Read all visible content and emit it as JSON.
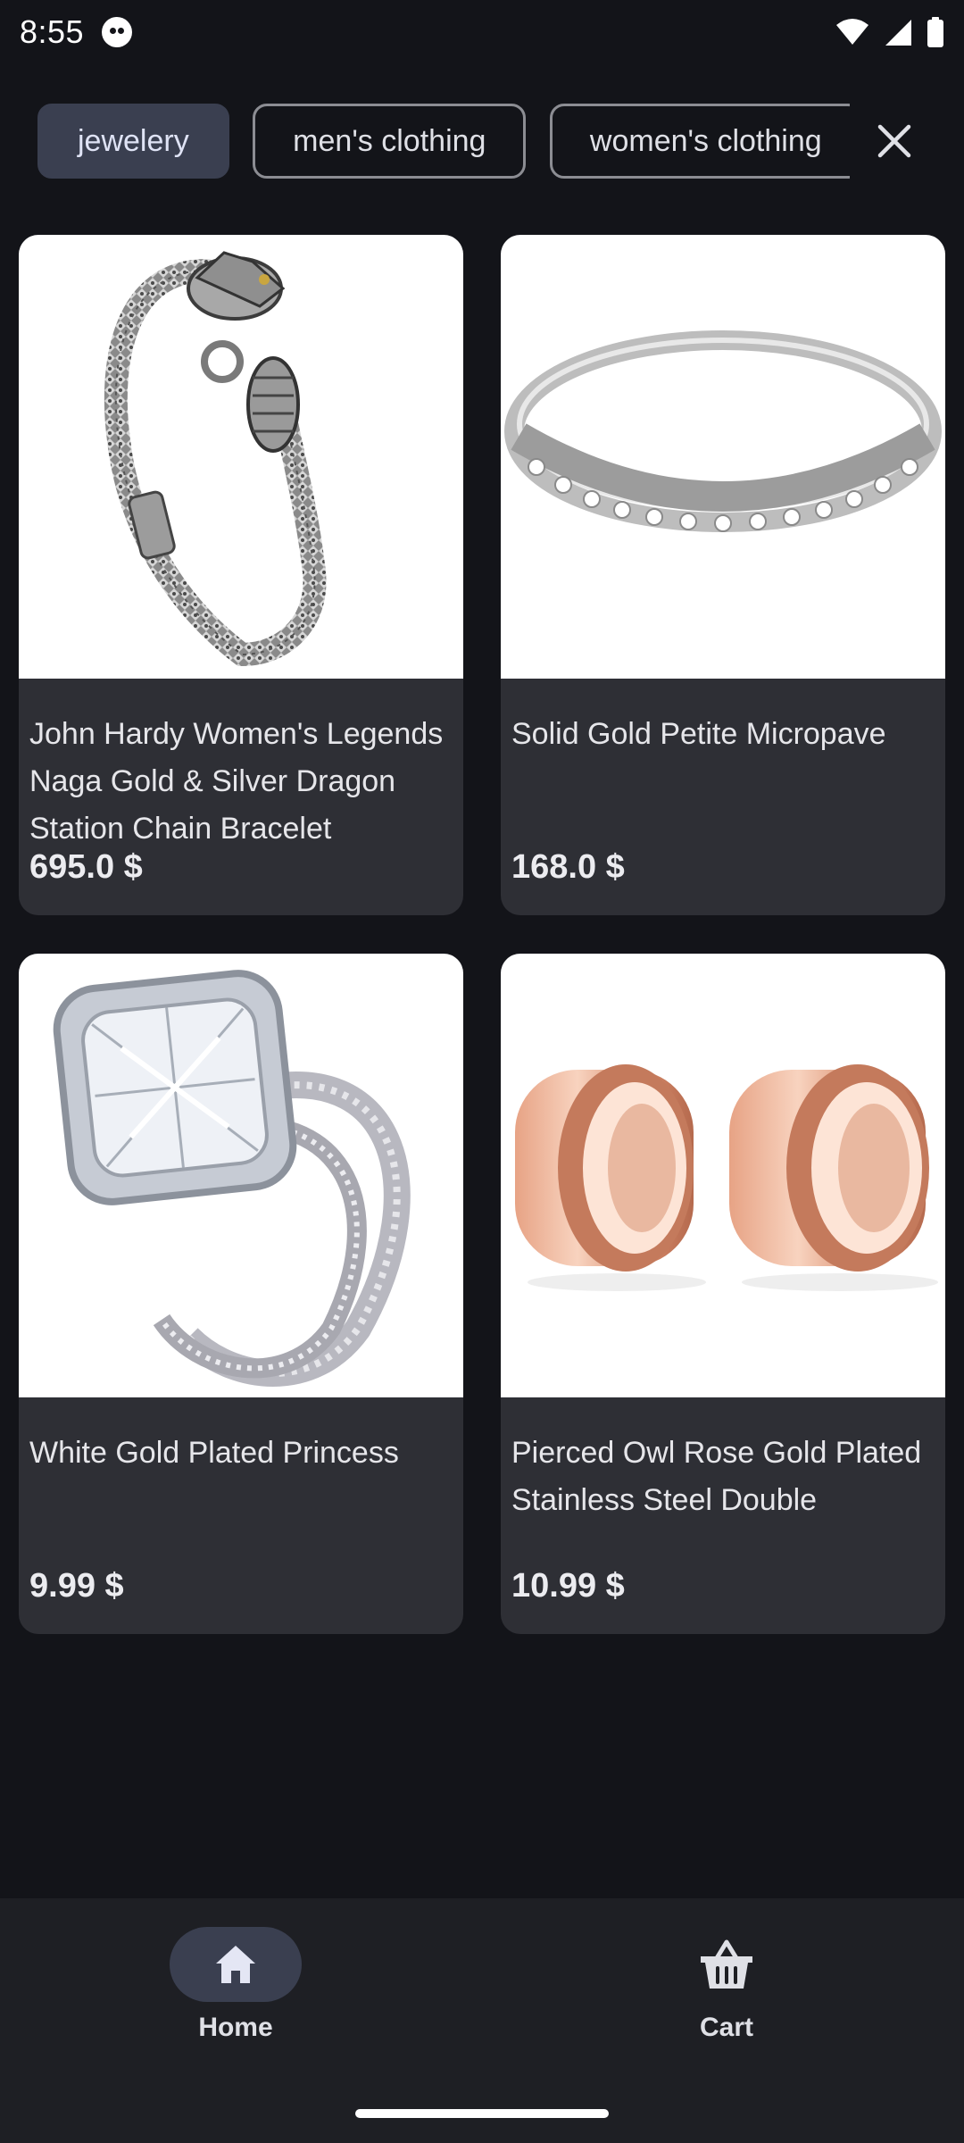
{
  "status_bar": {
    "time": "8:55",
    "icons": [
      "app-notification-icon",
      "wifi-icon",
      "signal-icon",
      "battery-icon"
    ]
  },
  "filters": {
    "chips": [
      {
        "label": "jewelery",
        "selected": true
      },
      {
        "label": "men's clothing",
        "selected": false
      },
      {
        "label": "women's clothing",
        "selected": false
      }
    ],
    "close_icon": "close-icon"
  },
  "products": [
    {
      "title": "John Hardy Women's Legends Naga Gold & Silver Dragon Station Chain Bracelet",
      "price": "695.0 $",
      "image": "dragon-chain-bracelet"
    },
    {
      "title": "Solid Gold Petite Micropave",
      "price": "168.0 $",
      "image": "micropave-ring"
    },
    {
      "title": "White Gold Plated Princess",
      "price": "9.99 $",
      "image": "princess-ring-set"
    },
    {
      "title": "Pierced Owl Rose Gold Plated Stainless Steel Double",
      "price": "10.99 $",
      "image": "rose-gold-tunnels"
    }
  ],
  "bottom_nav": {
    "items": [
      {
        "label": "Home",
        "icon": "home-icon",
        "selected": true
      },
      {
        "label": "Cart",
        "icon": "basket-icon",
        "selected": false
      }
    ]
  },
  "colors": {
    "background": "#131419",
    "card": "#2e2f35",
    "selected_chip": "#3a3f50",
    "nav_background": "#1e1f24"
  }
}
